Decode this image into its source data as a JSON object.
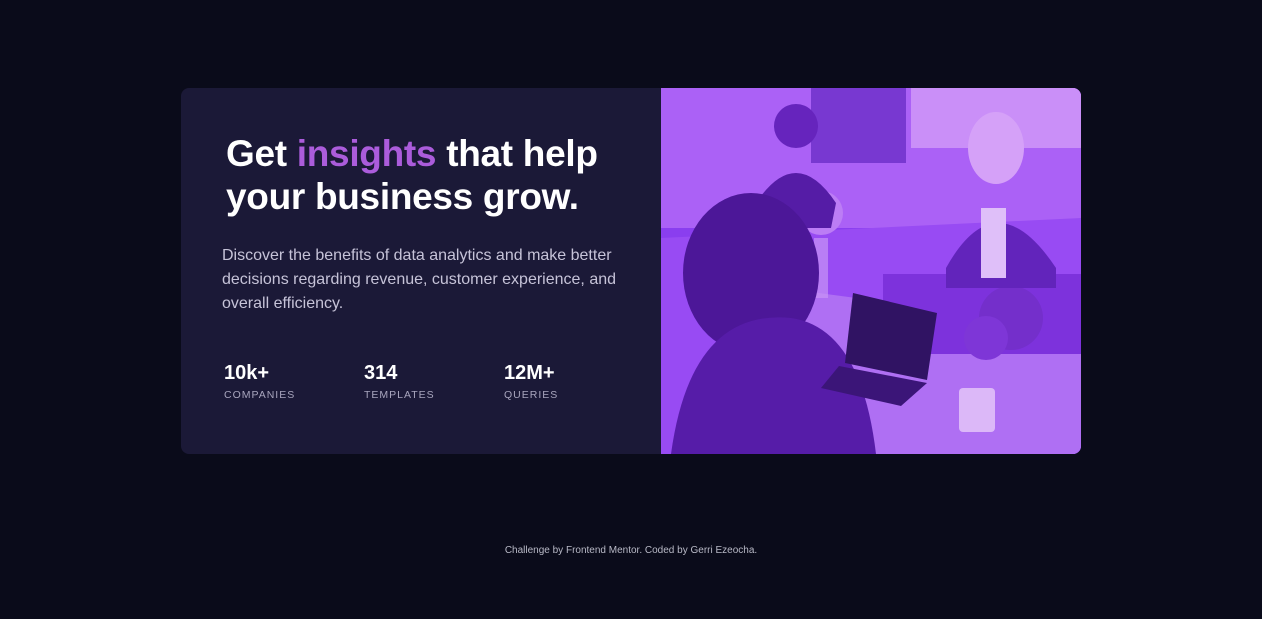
{
  "card": {
    "headline_before": "Get ",
    "headline_accent": "insights",
    "headline_after": " that help your business grow.",
    "description": "Discover the benefits of data analytics and make better decisions regarding revenue, customer experience, and overall efficiency.",
    "stats": [
      {
        "value": "10k+",
        "label": "COMPANIES"
      },
      {
        "value": "314",
        "label": "TEMPLATES"
      },
      {
        "value": "12M+",
        "label": "QUERIES"
      }
    ]
  },
  "footer": {
    "attribution": "Challenge by Frontend Mentor. Coded by Gerri Ezeocha."
  },
  "colors": {
    "page_bg": "#0a0b1a",
    "card_bg": "#1b1937",
    "accent": "#ab5cdb",
    "image_tint": "#8b3df0"
  }
}
